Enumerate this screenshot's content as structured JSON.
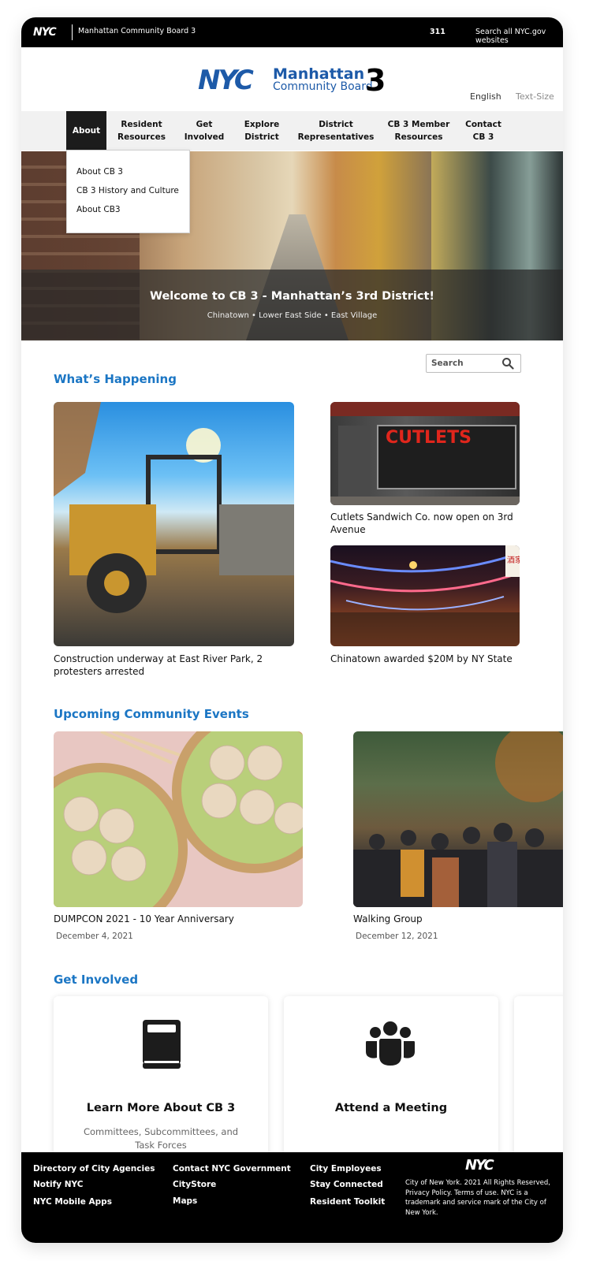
{
  "topbar": {
    "logo": "NYC",
    "site_name": "Manhattan Community Board 3",
    "n311": "311",
    "search_all": "Search all NYC.gov websites"
  },
  "header": {
    "brand_nyc": "NYC",
    "brand_line1": "Manhattan",
    "brand_line2": "Community Board",
    "brand_number": "3",
    "language": "English",
    "text_size": "Text-Size"
  },
  "nav": {
    "items": [
      {
        "label": "About"
      },
      {
        "label": "Resident Resources"
      },
      {
        "label": "Get Involved"
      },
      {
        "label": "Explore District"
      },
      {
        "label": "District Representatives"
      },
      {
        "label": "CB 3 Member Resources"
      },
      {
        "label": "Contact CB 3"
      }
    ],
    "dropdown": [
      "About CB 3",
      "CB 3 History and Culture",
      "About CB3"
    ]
  },
  "hero": {
    "title": "Welcome to CB 3 - Manhattan’s 3rd District!",
    "subtitle": "Chinatown • Lower East Side • East Village"
  },
  "search": {
    "placeholder": "Search"
  },
  "whats_happening": {
    "title": "What’s Happening",
    "stories": [
      {
        "caption": "Construction underway at East River Park, 2 protesters arrested"
      },
      {
        "caption": "Cutlets Sandwich Co. now open on 3rd Avenue",
        "sign": "CUTLETS"
      },
      {
        "caption": "Chinatown awarded $20M by NY State",
        "sign": "酒家"
      }
    ]
  },
  "events": {
    "title": "Upcoming Community Events",
    "items": [
      {
        "title": "DUMPCON 2021 - 10 Year Anniversary",
        "date": "December 4, 2021"
      },
      {
        "title": "Walking Group",
        "date": "December 12, 2021"
      }
    ]
  },
  "get_involved": {
    "title": "Get Involved",
    "cards": [
      {
        "title": "Learn More About CB 3",
        "desc": "Committees, Subcommittees, and Task Forces",
        "icon": "book-icon"
      },
      {
        "title": "Attend a Meeting",
        "desc": "",
        "icon": "people-icon"
      }
    ]
  },
  "footer": {
    "col1": [
      "Directory of City Agencies",
      "Notify NYC",
      "NYC Mobile Apps"
    ],
    "col2": [
      "Contact NYC Government",
      "CityStore",
      "Maps"
    ],
    "col3": [
      "City Employees",
      "Stay Connected",
      "Resident Toolkit"
    ],
    "logo": "NYC",
    "legal": "City of New York. 2021 All Rights Reserved, Privacy Policy. Terms of use. NYC is a trademark and service mark of the City of New York."
  },
  "colors": {
    "brand_blue": "#1d5aa8",
    "section_blue": "#1b76c4",
    "black": "#000000"
  }
}
